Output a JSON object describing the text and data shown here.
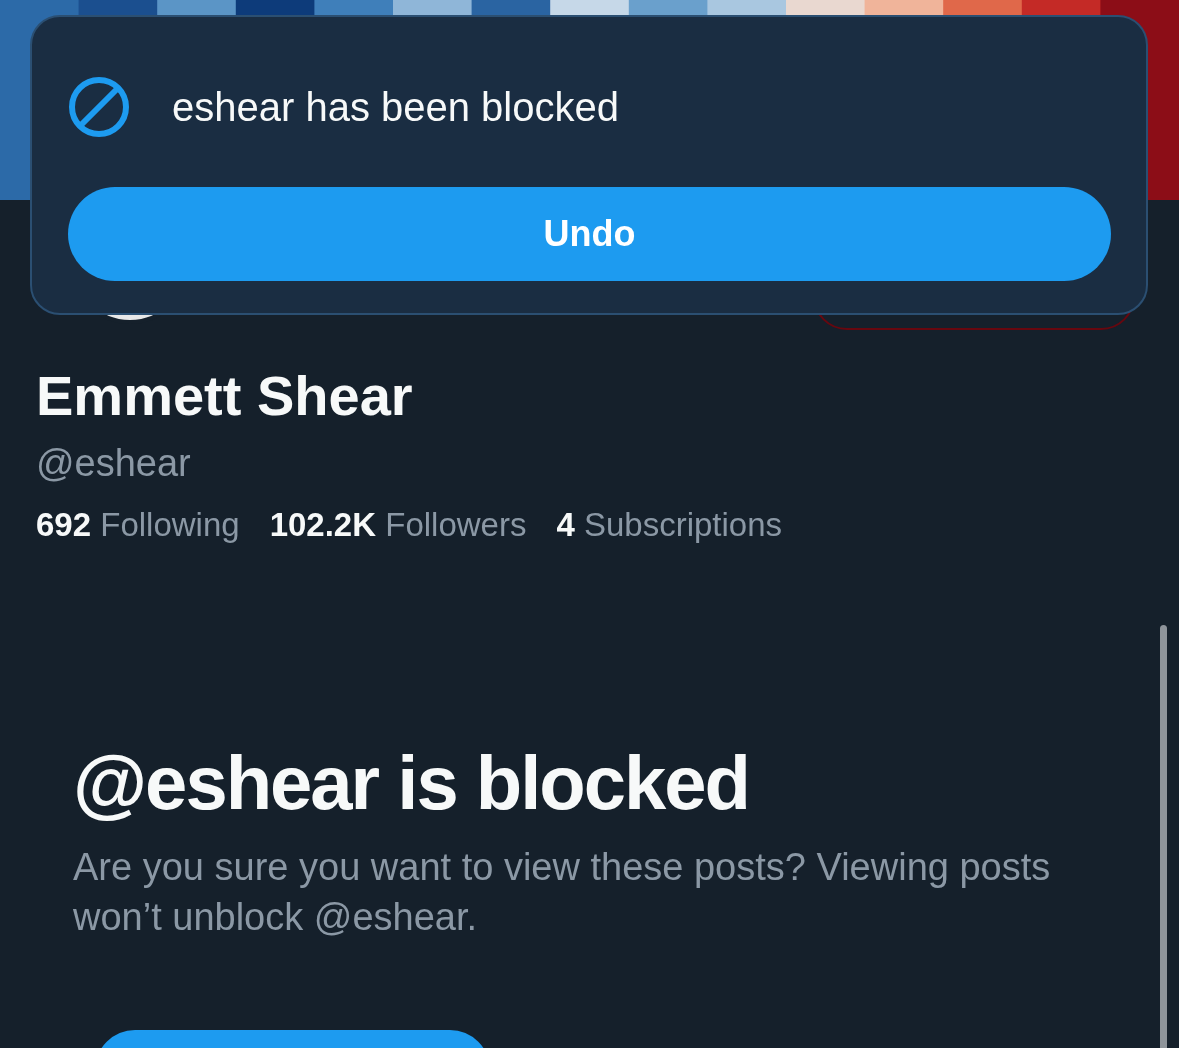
{
  "toast": {
    "message": "eshear has been blocked",
    "action": "Undo"
  },
  "profile": {
    "name": "Emmett Shear",
    "handle": "@eshear",
    "stats": [
      "**692** Following",
      "**102.2K** Followers",
      "**4** Subscriptions"
    ]
  },
  "blocked_notice": {
    "title": "@eshear is blocked",
    "description": "Are you sure you want to view these posts? Viewing posts won’t unblock @eshear."
  }
}
